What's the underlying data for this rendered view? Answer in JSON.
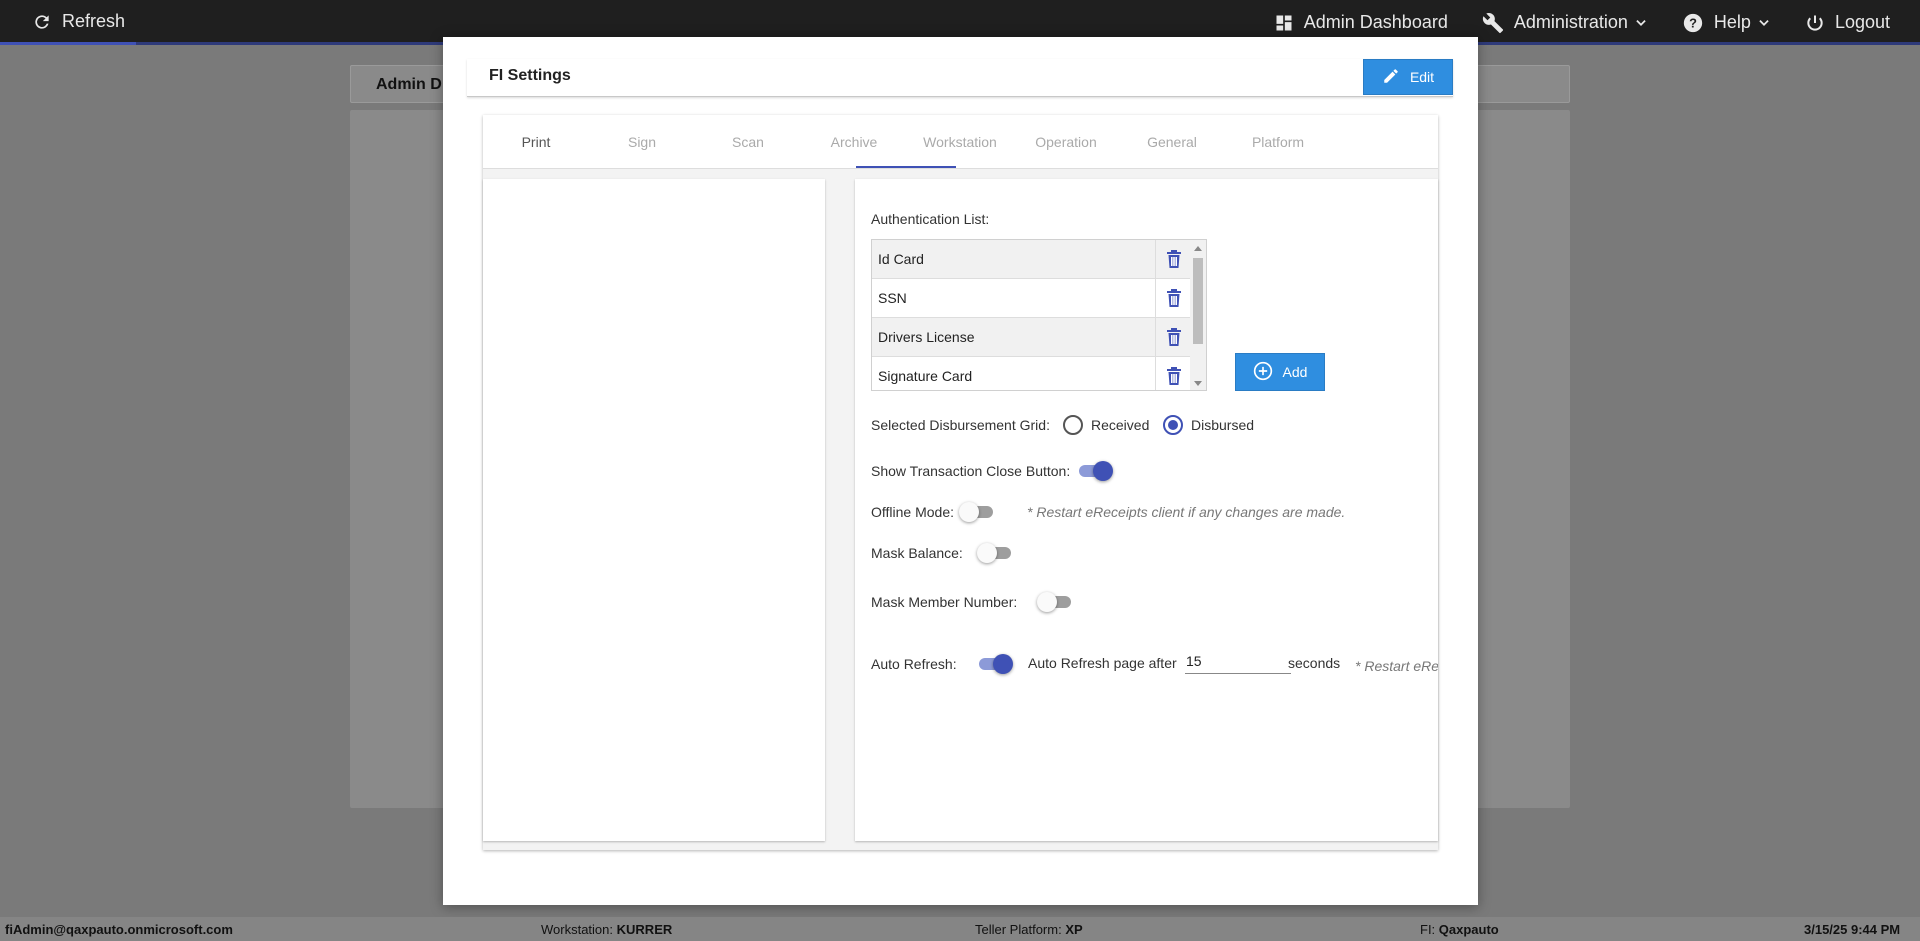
{
  "topbar": {
    "refresh": "Refresh",
    "admin_dashboard": "Admin Dashboard",
    "administration": "Administration",
    "help": "Help",
    "logout": "Logout"
  },
  "background": {
    "card_title": "Admin D"
  },
  "modal": {
    "title": "FI Settings",
    "edit_label": "Edit",
    "tabs": [
      {
        "label": "Print"
      },
      {
        "label": "Sign"
      },
      {
        "label": "Scan"
      },
      {
        "label": "Archive"
      },
      {
        "label": "Workstation"
      },
      {
        "label": "Operation"
      },
      {
        "label": "General"
      },
      {
        "label": "Platform"
      }
    ],
    "active_tab": "Workstation",
    "auth_list_label": "Authentication List:",
    "auth_items": [
      "Id Card",
      "SSN",
      "Drivers License",
      "Signature Card"
    ],
    "add_label": "Add",
    "disbursement_label": "Selected Disbursement Grid:",
    "radio_received": "Received",
    "radio_disbursed": "Disbursed",
    "disbursement_selected": "Disbursed",
    "show_close_label": "Show Transaction Close Button:",
    "show_close_on": true,
    "offline_label": "Offline Mode:",
    "offline_on": false,
    "offline_note": "* Restart eReceipts client if any changes are made.",
    "mask_balance_label": "Mask Balance:",
    "mask_balance_on": false,
    "mask_member_label": "Mask Member Number:",
    "mask_member_on": false,
    "auto_refresh_label": "Auto Refresh:",
    "auto_refresh_on": true,
    "auto_refresh_after_label": "Auto Refresh page after",
    "auto_refresh_value": "15",
    "seconds_label": "seconds",
    "auto_refresh_note": "* Restart eRe"
  },
  "statusbar": {
    "user": "fiAdmin@qaxpauto.onmicrosoft.com",
    "workstation_label": "Workstation:",
    "workstation_value": "KURRER",
    "teller_label": "Teller Platform:",
    "teller_value": "XP",
    "fi_label": "FI:",
    "fi_value": "Qaxpauto",
    "datetime": "3/15/25 9:44 PM"
  },
  "colors": {
    "accent": "#3f51b5",
    "button": "#2f8ee0",
    "topbar": "#1f1f1f"
  }
}
